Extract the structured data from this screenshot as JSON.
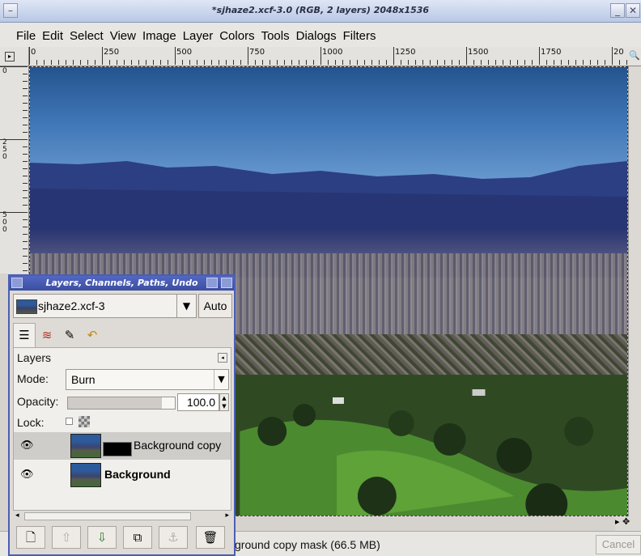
{
  "window": {
    "title": "*sjhaze2.xcf-3.0 (RGB, 2 layers) 2048x1536"
  },
  "menubar": [
    "File",
    "Edit",
    "Select",
    "View",
    "Image",
    "Layer",
    "Colors",
    "Tools",
    "Dialogs",
    "Filters"
  ],
  "ruler": {
    "h_labels": [
      "0",
      "250",
      "500",
      "750",
      "1000",
      "1250",
      "1500",
      "1750",
      "20"
    ],
    "v_labels": [
      "0",
      "2 5 0",
      "5 0 0"
    ]
  },
  "status": {
    "text": "ground copy mask (66.5 MB)",
    "cancel_label": "Cancel"
  },
  "dock": {
    "title": "Layers, Channels, Paths, Undo",
    "image_name": "sjhaze2.xcf-3",
    "auto_label": "Auto",
    "tabs": [
      "layers-tab-icon",
      "channels-tab-icon",
      "paths-tab-icon",
      "undo-tab-icon"
    ],
    "layers_label": "Layers",
    "mode_label": "Mode:",
    "mode_value": "Burn",
    "opacity_label": "Opacity:",
    "opacity_value": "100.0",
    "opacity_fraction": 1.0,
    "lock_label": "Lock:",
    "layers": [
      {
        "name": "Background copy",
        "selected": true,
        "has_mask": true,
        "bold": false
      },
      {
        "name": "Background",
        "selected": false,
        "has_mask": false,
        "bold": true
      }
    ],
    "buttons": [
      "new-layer-icon",
      "raise-layer-icon",
      "lower-layer-icon",
      "duplicate-layer-icon",
      "anchor-layer-icon",
      "delete-layer-icon"
    ]
  }
}
